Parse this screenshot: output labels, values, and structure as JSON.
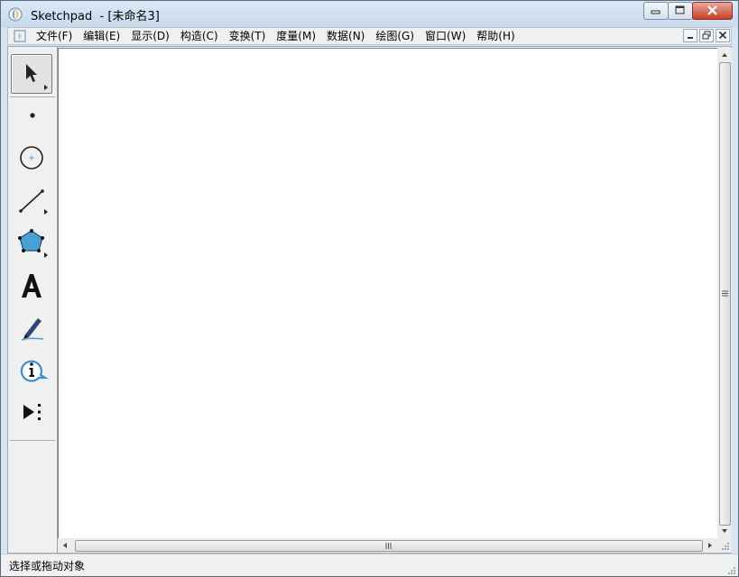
{
  "window": {
    "app_name": "Sketchpad",
    "title_suffix": "  - [未命名3]"
  },
  "menu": {
    "items": [
      "文件(F)",
      "编辑(E)",
      "显示(D)",
      "构造(C)",
      "变换(T)",
      "度量(M)",
      "数据(N)",
      "绘图(G)",
      "窗口(W)",
      "帮助(H)"
    ]
  },
  "toolbox": {
    "tools": [
      {
        "name": "select-arrow-tool",
        "icon": "arrow-pointer-icon",
        "selected": true
      },
      {
        "name": "point-tool",
        "icon": "point-icon",
        "selected": false
      },
      {
        "name": "compass-tool",
        "icon": "circle-icon",
        "selected": false
      },
      {
        "name": "straightedge-tool",
        "icon": "segment-icon",
        "selected": false
      },
      {
        "name": "polygon-tool",
        "icon": "pentagon-icon",
        "selected": false
      },
      {
        "name": "text-tool",
        "icon": "text-A-icon",
        "selected": false
      },
      {
        "name": "marker-tool",
        "icon": "marker-pen-icon",
        "selected": false
      },
      {
        "name": "information-tool",
        "icon": "info-bubble-icon",
        "selected": false
      },
      {
        "name": "custom-tool",
        "icon": "play-more-icon",
        "selected": false
      }
    ]
  },
  "status": {
    "text": "选择或拖动对象"
  },
  "colors": {
    "titlebar": "#c9d9ec",
    "close_button": "#c7402a",
    "polygon_fill": "#4a9fd6",
    "canvas": "#ffffff"
  }
}
